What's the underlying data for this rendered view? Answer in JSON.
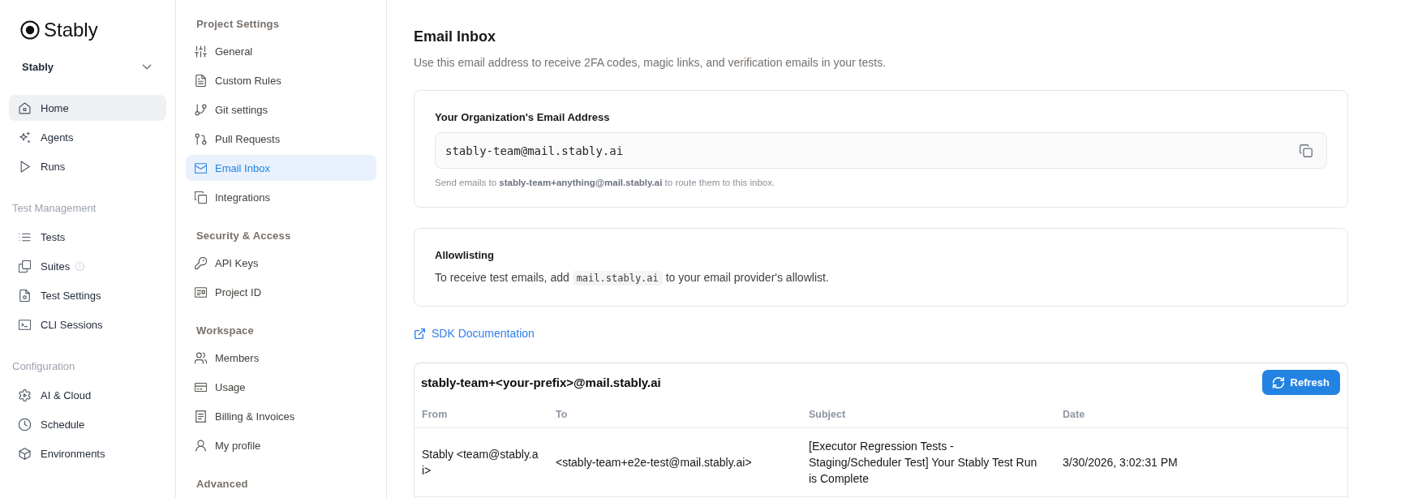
{
  "brand": {
    "name": "Stably"
  },
  "workspace": {
    "value": "Stably"
  },
  "nav": {
    "sections": [
      {
        "items": [
          {
            "label": "Home",
            "selected": true,
            "info": false
          },
          {
            "label": "Agents",
            "selected": false,
            "info": false
          },
          {
            "label": "Runs",
            "selected": false,
            "info": false
          }
        ]
      },
      {
        "heading": "Test Management",
        "items": [
          {
            "label": "Tests",
            "selected": false,
            "info": false
          },
          {
            "label": "Suites",
            "selected": false,
            "info": true
          },
          {
            "label": "Test Settings",
            "selected": false,
            "info": false
          },
          {
            "label": "CLI Sessions",
            "selected": false,
            "info": false
          }
        ]
      },
      {
        "heading": "Configuration",
        "items": [
          {
            "label": "AI & Cloud",
            "selected": false,
            "info": false
          },
          {
            "label": "Schedule",
            "selected": false,
            "info": false
          },
          {
            "label": "Environments",
            "selected": false,
            "info": false
          }
        ]
      }
    ]
  },
  "settings_nav": {
    "sections": [
      {
        "heading": "Project Settings",
        "items": [
          {
            "label": "General",
            "selected": false
          },
          {
            "label": "Custom Rules",
            "selected": false
          },
          {
            "label": "Git settings",
            "selected": false
          },
          {
            "label": "Pull Requests",
            "selected": false
          },
          {
            "label": "Email Inbox",
            "selected": true
          },
          {
            "label": "Integrations",
            "selected": false
          }
        ]
      },
      {
        "heading": "Security & Access",
        "items": [
          {
            "label": "API Keys",
            "selected": false
          },
          {
            "label": "Project ID",
            "selected": false
          }
        ]
      },
      {
        "heading": "Workspace",
        "items": [
          {
            "label": "Members",
            "selected": false
          },
          {
            "label": "Usage",
            "selected": false
          },
          {
            "label": "Billing & Invoices",
            "selected": false
          },
          {
            "label": "My profile",
            "selected": false
          }
        ]
      },
      {
        "heading": "Advanced"
      }
    ]
  },
  "page": {
    "title": "Email Inbox",
    "description": "Use this email address to receive 2FA codes, magic links, and verification emails in your tests."
  },
  "address_card": {
    "label": "Your Organization's Email Address",
    "value": "stably-team@mail.stably.ai",
    "hint": "Send emails to **stably-team+anything@mail.stably.ai** to route them to this inbox."
  },
  "allowlist_card": {
    "title": "Allowlisting",
    "text_before": "To receive test emails, add",
    "code": "mail.stably.ai",
    "text_after": "to your email provider's allowlist."
  },
  "docs_link": {
    "label": "SDK Documentation"
  },
  "inbox": {
    "title": "stably-team+<your-prefix>@mail.stably.ai",
    "refresh_label": "Refresh",
    "columns": [
      "From",
      "To",
      "Subject",
      "Date"
    ],
    "rows": [
      {
        "cells": [
          "Stably <team@stably.ai>",
          "<stably-team+e2e-test@mail.stably.ai>",
          "[Executor Regression Tests - Staging/Scheduler Test] Your Stably Test Run is Complete",
          "3/30/2026, 3:02:31 PM"
        ]
      }
    ]
  }
}
